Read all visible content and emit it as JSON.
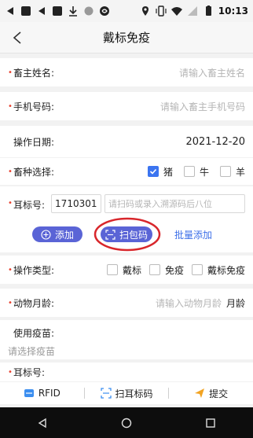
{
  "status_bar": {
    "time": "10:13"
  },
  "header": {
    "title": "戴标免疫"
  },
  "form": {
    "owner": {
      "label": "畜主姓名:",
      "placeholder": "请输入畜主姓名"
    },
    "phone": {
      "label": "手机号码:",
      "placeholder": "请输入畜主手机号码"
    },
    "date": {
      "label": "操作日期:",
      "value": "2021-12-20"
    },
    "species": {
      "label": "畜种选择:",
      "options": [
        {
          "label": "猪",
          "checked": true
        },
        {
          "label": "牛",
          "checked": false
        },
        {
          "label": "羊",
          "checked": false
        }
      ]
    },
    "ear_tag": {
      "label": "耳标号:",
      "prefix_value": "1710301",
      "placeholder": "请扫码或录入溯源码后八位"
    },
    "actions": {
      "add": "添加",
      "scan_package": "扫包码",
      "batch_add": "批量添加"
    },
    "operation": {
      "label": "操作类型:",
      "options": [
        {
          "label": "戴标",
          "checked": false
        },
        {
          "label": "免疫",
          "checked": false
        },
        {
          "label": "戴标免疫",
          "checked": false
        }
      ]
    },
    "age": {
      "label": "动物月龄:",
      "placeholder": "请输入动物月龄",
      "unit": "月龄"
    },
    "vaccine": {
      "label": "使用疫苗:",
      "placeholder": "请选择疫苗"
    },
    "ear_list": {
      "label": "耳标号:"
    }
  },
  "bottom_tools": {
    "rfid": "RFID",
    "scan_ear": "扫耳标码",
    "submit": "提交"
  },
  "colors": {
    "accent": "#5a64d6",
    "required": "#e8412f",
    "link": "#3c6fe8",
    "annotation": "#d8262b"
  }
}
